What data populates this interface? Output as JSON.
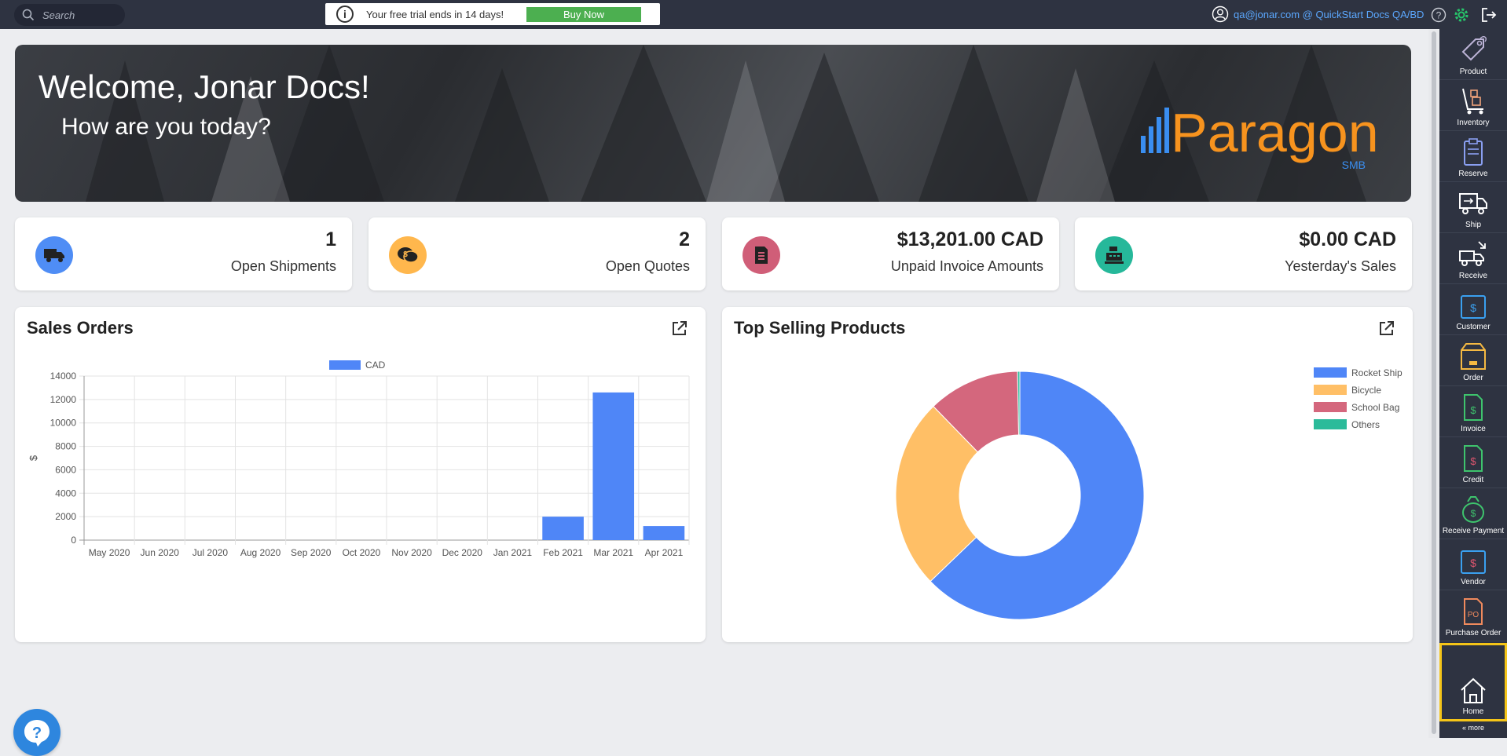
{
  "topbar": {
    "search_placeholder": "Search",
    "trial_message": "Your free trial ends in 14 days!",
    "buy_label": "Buy Now",
    "user_text": "qa@jonar.com @ QuickStart Docs QA/BD"
  },
  "banner": {
    "welcome": "Welcome, Jonar Docs!",
    "subtitle": "How are you today?",
    "logo_text": "Paragon",
    "logo_sub": "SMB"
  },
  "cards": [
    {
      "value": "1",
      "label": "Open Shipments",
      "icon": "truck-icon",
      "color": "#4f8df5"
    },
    {
      "value": "2",
      "label": "Open Quotes",
      "icon": "quote-chat-icon",
      "color": "#ffb74d"
    },
    {
      "value": "$13,201.00 CAD",
      "label": "Unpaid Invoice Amounts",
      "icon": "invoice-icon",
      "color": "#d05e78"
    },
    {
      "value": "$0.00 CAD",
      "label": "Yesterday's Sales",
      "icon": "cash-register-icon",
      "color": "#26b89a"
    }
  ],
  "sales_orders": {
    "title": "Sales Orders",
    "chart_data": {
      "type": "bar",
      "categories": [
        "May 2020",
        "Jun 2020",
        "Jul 2020",
        "Aug 2020",
        "Sep 2020",
        "Oct 2020",
        "Nov 2020",
        "Dec 2020",
        "Jan 2021",
        "Feb 2021",
        "Mar 2021",
        "Apr 2021"
      ],
      "series": [
        {
          "name": "CAD",
          "values": [
            0,
            0,
            0,
            0,
            0,
            0,
            0,
            0,
            0,
            2000,
            12600,
            1200
          ],
          "color": "#4f86f7"
        }
      ],
      "ylabel": "$",
      "xlabel": "",
      "ylim": [
        0,
        14000
      ],
      "yticks": [
        0,
        2000,
        4000,
        6000,
        8000,
        10000,
        12000,
        14000
      ],
      "grid": true,
      "legend": "top"
    }
  },
  "top_selling": {
    "title": "Top Selling Products",
    "chart_data": {
      "type": "pie",
      "categories": [
        "Rocket Ship",
        "Bicycle",
        "School Bag",
        "Others"
      ],
      "values": [
        63,
        25,
        12,
        0.3
      ],
      "colors": [
        "#4f86f7",
        "#ffbf66",
        "#d4677d",
        "#2bbb9a"
      ],
      "legend": "top-right"
    }
  },
  "sidebar": {
    "items": [
      {
        "label": "Product",
        "icon": "product-tag-icon"
      },
      {
        "label": "Inventory",
        "icon": "inventory-cart-icon"
      },
      {
        "label": "Reserve",
        "icon": "reserve-clipboard-icon"
      },
      {
        "label": "Ship",
        "icon": "ship-truck-icon"
      },
      {
        "label": "Receive",
        "icon": "receive-truck-icon"
      },
      {
        "label": "Customer",
        "icon": "customer-icon"
      },
      {
        "label": "Order",
        "icon": "order-box-icon"
      },
      {
        "label": "Invoice",
        "icon": "invoice-doc-icon"
      },
      {
        "label": "Credit",
        "icon": "credit-doc-icon"
      },
      {
        "label": "Receive Payment",
        "icon": "payment-bag-icon"
      },
      {
        "label": "Vendor",
        "icon": "vendor-icon"
      },
      {
        "label": "Purchase Order",
        "icon": "purchase-order-icon"
      }
    ],
    "home_label": "Home",
    "more_label": "« more"
  }
}
